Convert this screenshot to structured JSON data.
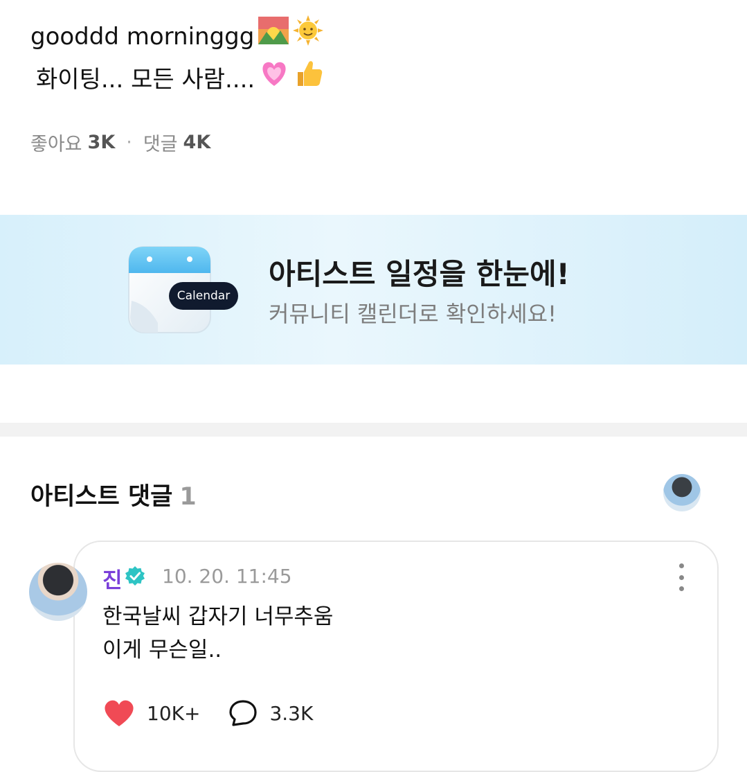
{
  "post": {
    "line1": "gooddd morninggg",
    "line1_emojis": [
      "sunrise-over-mountains-emoji",
      "sun-with-face-emoji"
    ],
    "line2": "화이팅... 모든 사람....",
    "line2_emojis": [
      "growing-heart-emoji",
      "thumbs-up-emoji"
    ]
  },
  "stats": {
    "likes_label": "좋아요",
    "likes_count": "3K",
    "separator": "·",
    "comments_label": "댓글",
    "comments_count": "4K"
  },
  "banner": {
    "badge": "Calendar",
    "title": "아티스트 일정을 한눈에!",
    "subtitle": "커뮤니티 캘린더로 확인하세요!"
  },
  "artist_comments": {
    "title": "아티스트 댓글",
    "count": "1"
  },
  "comment": {
    "author": "진",
    "timestamp": "10. 20. 11:45",
    "lines": [
      "한국날씨 갑자기 너무추움",
      "이게 무슨일.."
    ],
    "likes": "10K+",
    "replies": "3.3K"
  },
  "colors": {
    "author": "#7a3fd9",
    "verified": "#2ec4c4",
    "heart": "#f04a55",
    "banner_bg": "#d7f0fb"
  }
}
